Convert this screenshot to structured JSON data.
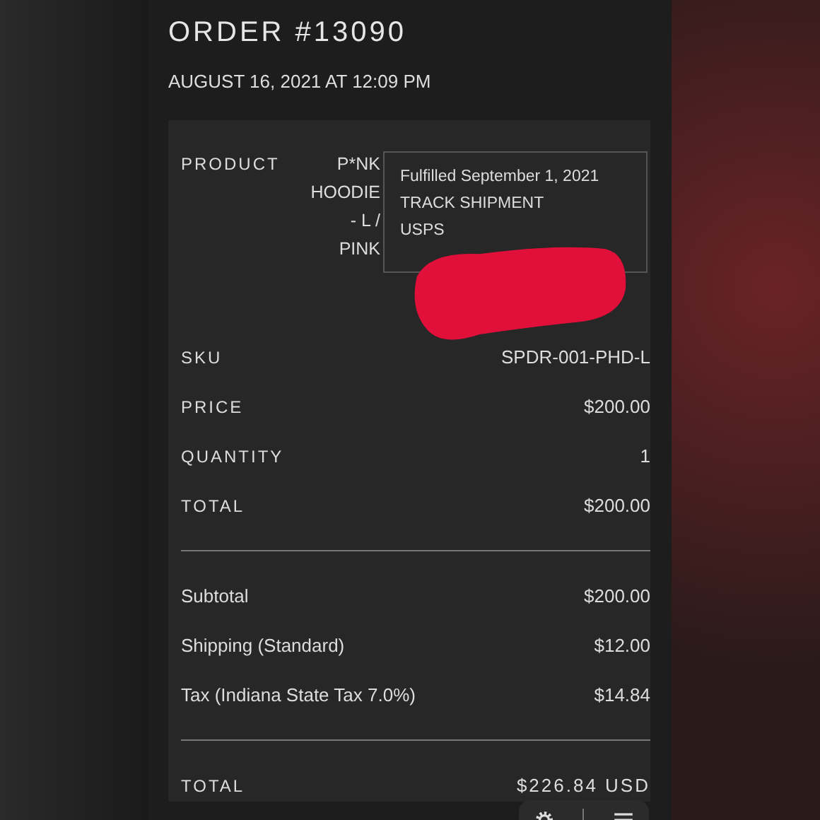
{
  "order": {
    "title": "ORDER #13090",
    "date": "AUGUST 16, 2021 AT 12:09 PM"
  },
  "product": {
    "label": "PRODUCT",
    "name_lines": [
      "P*NK",
      "HOODIE",
      "- L /",
      "PINK"
    ]
  },
  "fulfillment": {
    "status": "Fulfilled September 1, 2021",
    "link": "TRACK SHIPMENT",
    "carrier": "USPS",
    "redacted": true
  },
  "details": [
    {
      "label": "SKU",
      "value": "SPDR-001-PHD-L"
    },
    {
      "label": "PRICE",
      "value": "$200.00"
    },
    {
      "label": "QUANTITY",
      "value": "1"
    },
    {
      "label": "TOTAL",
      "value": "$200.00"
    }
  ],
  "summary": [
    {
      "label": "Subtotal",
      "value": "$200.00"
    },
    {
      "label": "Shipping (Standard)",
      "value": "$12.00"
    },
    {
      "label": "Tax (Indiana State Tax 7.0%)",
      "value": "$14.84"
    }
  ],
  "grand_total": {
    "label": "TOTAL",
    "value": "$226.84 USD"
  }
}
